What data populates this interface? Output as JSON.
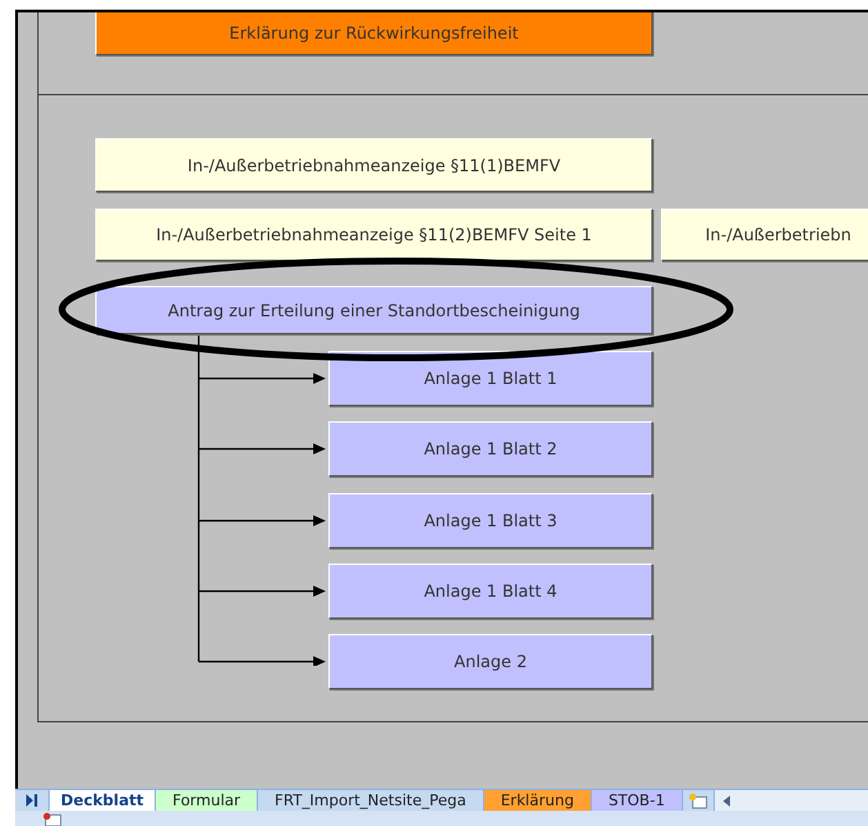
{
  "sheet": {
    "top_button": {
      "label": "Erklärung zur Rückwirkungsfreiheit",
      "color": "#ff8000"
    },
    "buttons": [
      {
        "label": "In-/Außerbetriebnahmeanzeige §11(1)BEMFV",
        "color": "#ffffe0"
      },
      {
        "label": "In-/Außerbetriebnahmeanzeige §11(2)BEMFV Seite 1",
        "color": "#ffffe0"
      },
      {
        "label": "In-/Außerbetriebn",
        "color": "#ffffe0"
      },
      {
        "label": "Antrag zur Erteilung einer Standortbescheinigung",
        "color": "#c0c0ff"
      }
    ],
    "sub_buttons": [
      {
        "label": "Anlage 1 Blatt 1"
      },
      {
        "label": "Anlage 1 Blatt 2"
      },
      {
        "label": "Anlage 1 Blatt 3"
      },
      {
        "label": "Anlage 1 Blatt 4"
      },
      {
        "label": "Anlage 2"
      }
    ]
  },
  "sheet_tabs": [
    {
      "label": "Deckblatt",
      "selected": true,
      "color": "#ffffff"
    },
    {
      "label": "Formular",
      "selected": false,
      "color": "#ccffcc"
    },
    {
      "label": "FRT_Import_Netsite_Pega",
      "selected": false,
      "color": "#c5d9f1"
    },
    {
      "label": "Erklärung",
      "selected": false,
      "color": "#ffa030"
    },
    {
      "label": "STOB-1",
      "selected": false,
      "color": "#c0c0ff"
    }
  ]
}
